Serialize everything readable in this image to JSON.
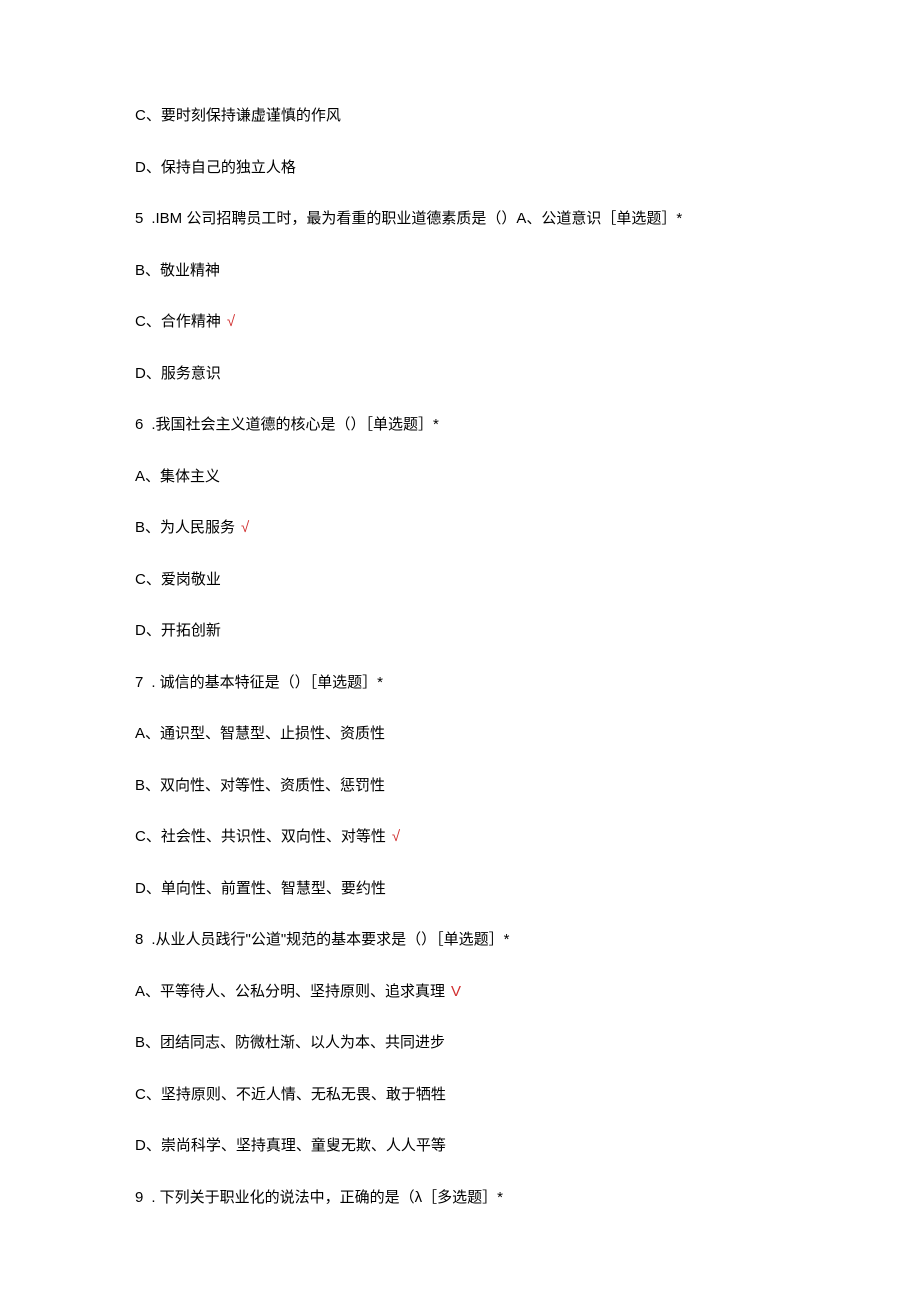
{
  "lines": [
    {
      "text": "C、要时刻保持谦虚谨慎的作风",
      "correct": ""
    },
    {
      "text": "D、保持自己的独立人格",
      "correct": ""
    },
    {
      "num": "5",
      "text": ".IBM 公司招聘员工时，最为看重的职业道德素质是（）A、公道意识［单选题］*",
      "correct": ""
    },
    {
      "text": "B、敬业精神",
      "correct": ""
    },
    {
      "text": "C、合作精神",
      "correct": "√"
    },
    {
      "text": "D、服务意识",
      "correct": ""
    },
    {
      "num": "6",
      "text": ".我国社会主义道德的核心是（）［单选题］*",
      "correct": ""
    },
    {
      "text": "A、集体主义",
      "correct": ""
    },
    {
      "text": "B、为人民服务",
      "correct": "√"
    },
    {
      "text": "C、爱岗敬业",
      "correct": ""
    },
    {
      "text": "D、开拓创新",
      "correct": ""
    },
    {
      "num": "7",
      "text": ". 诚信的基本特征是（）［单选题］*",
      "correct": ""
    },
    {
      "text": "A、通识型、智慧型、止损性、资质性",
      "correct": ""
    },
    {
      "text": "B、双向性、对等性、资质性、惩罚性",
      "correct": ""
    },
    {
      "text": "C、社会性、共识性、双向性、对等性",
      "correct": "√"
    },
    {
      "text": "D、单向性、前置性、智慧型、要约性",
      "correct": ""
    },
    {
      "num": "8",
      "text": ".从业人员践行\"公道\"规范的基本要求是（）［单选题］*",
      "correct": ""
    },
    {
      "text": "A、平等待人、公私分明、坚持原则、追求真理",
      "correct": "V"
    },
    {
      "text": "B、团结同志、防微杜渐、以人为本、共同进步",
      "correct": ""
    },
    {
      "text": "C、坚持原则、不近人情、无私无畏、敢于牺牲",
      "correct": ""
    },
    {
      "text": "D、崇尚科学、坚持真理、童叟无欺、人人平等",
      "correct": ""
    },
    {
      "num": "9",
      "text": ". 下列关于职业化的说法中，正确的是（λ［多选题］*",
      "correct": ""
    }
  ]
}
